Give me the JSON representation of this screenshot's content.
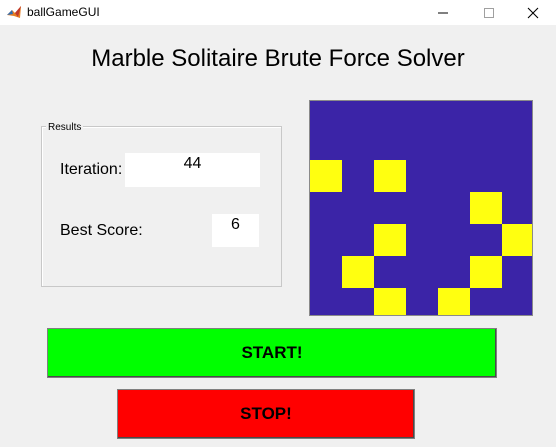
{
  "window": {
    "title": "ballGameGUI",
    "app_icon": "matlab-icon",
    "controls": [
      "minimize-icon",
      "maximize-icon",
      "close-icon"
    ]
  },
  "heading": "Marble Solitaire Brute Force Solver",
  "results": {
    "legend": "Results",
    "iteration_label": "Iteration:",
    "iteration_value": "44",
    "best_score_label": "Best Score:",
    "best_score_value": "6"
  },
  "board": {
    "rows": 6,
    "cols": 7,
    "background_color": "#3b24a7",
    "marble_color": "#ffff10",
    "marbles": [
      [
        1,
        0
      ],
      [
        1,
        2
      ],
      [
        2,
        5
      ],
      [
        3,
        2
      ],
      [
        3,
        6
      ],
      [
        4,
        1
      ],
      [
        4,
        5
      ],
      [
        5,
        2
      ],
      [
        5,
        4
      ]
    ]
  },
  "buttons": {
    "start_label": "START!",
    "start_color": "#00ff00",
    "stop_label": "STOP!",
    "stop_color": "#ff0000"
  }
}
